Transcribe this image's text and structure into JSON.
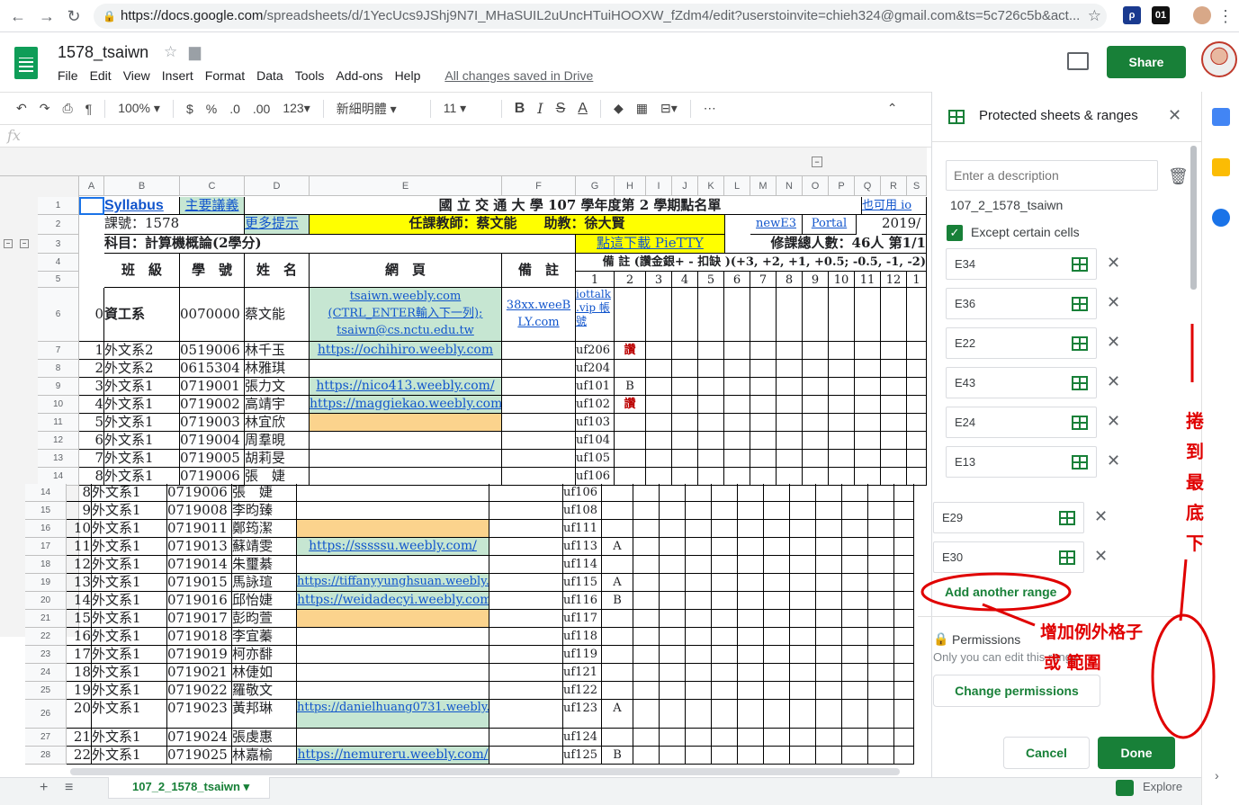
{
  "browser": {
    "url_host": "https://docs.google.com",
    "url_path": "/spreadsheets/d/1YecUcs9JShj9N7I_MHaSUIL2uUncHTuiHOOXW_fZdm4/edit?userstoinvite=chieh324@gmail.com&ts=5c726c5b&act..."
  },
  "doc": {
    "title": "1578_tsaiwn",
    "menus": [
      "File",
      "Edit",
      "View",
      "Insert",
      "Format",
      "Data",
      "Tools",
      "Add-ons",
      "Help"
    ],
    "saved_status": "All changes saved in Drive",
    "share_label": "Share"
  },
  "toolbar": {
    "zoom": "100%",
    "currency": "$",
    "percent": "%",
    "dec_less": ".0",
    "dec_more": ".00",
    "format_more": "123",
    "font": "新細明體",
    "font_size": "11",
    "bold": "B",
    "italic": "I",
    "strike": "S",
    "textcolor": "A"
  },
  "fx": "fx",
  "columns": [
    "A",
    "B",
    "C",
    "D",
    "E",
    "F",
    "G",
    "H",
    "I",
    "J",
    "K",
    "L",
    "M",
    "N",
    "O",
    "P",
    "Q",
    "R",
    "S"
  ],
  "top_rows": {
    "r1": {
      "num": "1",
      "b": "Syllabus",
      "c": "主要議義",
      "title": "國 立 交 通 大 學 107 學年度第 2 學期點名單",
      "right": "也可用 io"
    },
    "r2": {
      "num": "2",
      "b": "課號：1578",
      "c": "更多提示",
      "teacher": "任課教師：蔡文能　　助教：徐大賢",
      "newe3": "newE3",
      "portal": "Portal",
      "year": "2019/"
    },
    "r3": {
      "num": "3",
      "b": "科目：計算機概論(2學分)",
      "g": "點這下載 PieTTY",
      "total": "修課總人數：46人 第1/1"
    },
    "r4": {
      "num": "4",
      "b": "班　級",
      "c": "學　號",
      "d": "姓　名",
      "e": "網　頁",
      "f": "備　註",
      "notes": "備 註 (讚金銀+ - 扣缺 )(+3, +2, +1, +0.5; -0.5, -1, -2)"
    },
    "r5": {
      "num": "5",
      "nums": [
        "1",
        "2",
        "3",
        "4",
        "5",
        "6",
        "7",
        "8",
        "9",
        "10",
        "11",
        "12",
        "1"
      ]
    },
    "r6": {
      "num": "6",
      "a": "0",
      "b": "資工系",
      "c": "0070000",
      "d": "蔡文能",
      "e1": "tsaiwn.weebly.com",
      "e2": "(CTRL_ENTER輸入下一列);",
      "e3": "tsaiwn@cs.nctu.edu.tw",
      "f": "38xx.weeB LY.com",
      "g": "iottalk .vip 帳號"
    }
  },
  "rows": [
    {
      "num": "7",
      "a": "1",
      "b": "外文系2",
      "c": "0519006",
      "d": "林千玉",
      "e": "https://ochihiro.weebly.com",
      "g": "uf206",
      "h": "讚"
    },
    {
      "num": "8",
      "a": "2",
      "b": "外文系2",
      "c": "0615304",
      "d": "林雅琪",
      "e": "",
      "g": "uf204",
      "h": ""
    },
    {
      "num": "9",
      "a": "3",
      "b": "外文系1",
      "c": "0719001",
      "d": "張力文",
      "e": "https://nico413.weebly.com/",
      "g": "uf101",
      "h": "B"
    },
    {
      "num": "10",
      "a": "4",
      "b": "外文系1",
      "c": "0719002",
      "d": "高靖宇",
      "e": "https://maggiekao.weebly.com/",
      "g": "uf102",
      "h": "讚"
    },
    {
      "num": "11",
      "a": "5",
      "b": "外文系1",
      "c": "0719003",
      "d": "林宜欣",
      "e": "",
      "g": "uf103",
      "h": ""
    },
    {
      "num": "12",
      "a": "6",
      "b": "外文系1",
      "c": "0719004",
      "d": "周羣晛",
      "e": "",
      "g": "uf104",
      "h": ""
    },
    {
      "num": "13",
      "a": "7",
      "b": "外文系1",
      "c": "0719005",
      "d": "胡莉旻",
      "e": "",
      "g": "uf105",
      "h": ""
    },
    {
      "num": "14",
      "a": "8",
      "b": "外文系1",
      "c": "0719006",
      "d": "張　婕",
      "e": "",
      "g": "uf106",
      "h": ""
    }
  ],
  "rows2": [
    {
      "num": "14",
      "a": "8",
      "b": "外文系1",
      "c": "0719006",
      "d": "張　婕",
      "e": "",
      "g": "uf106",
      "h": ""
    },
    {
      "num": "15",
      "a": "9",
      "b": "外文系1",
      "c": "0719008",
      "d": "李昀臻",
      "e": "",
      "g": "uf108",
      "h": ""
    },
    {
      "num": "16",
      "a": "10",
      "b": "外文系1",
      "c": "0719011",
      "d": "鄭筠潔",
      "e": "",
      "g": "uf111",
      "h": ""
    },
    {
      "num": "17",
      "a": "11",
      "b": "外文系1",
      "c": "0719013",
      "d": "蘇靖雯",
      "e": "https://sssssu.weebly.com/",
      "g": "uf113",
      "h": "A"
    },
    {
      "num": "18",
      "a": "12",
      "b": "外文系1",
      "c": "0719014",
      "d": "朱璽綦",
      "e": "",
      "g": "uf114",
      "h": ""
    },
    {
      "num": "19",
      "a": "13",
      "b": "外文系1",
      "c": "0719015",
      "d": "馬詠瑄",
      "e": "https://tiffanyyunghsuan.weebly.com",
      "g": "uf115",
      "h": "A"
    },
    {
      "num": "20",
      "a": "14",
      "b": "外文系1",
      "c": "0719016",
      "d": "邱怡婕",
      "e": "https://weidadecyi.weebly.com",
      "g": "uf116",
      "h": "B"
    },
    {
      "num": "21",
      "a": "15",
      "b": "外文系1",
      "c": "0719017",
      "d": "彭昀萱",
      "e": "",
      "g": "uf117",
      "h": ""
    },
    {
      "num": "22",
      "a": "16",
      "b": "外文系1",
      "c": "0719018",
      "d": "李宜蓁",
      "e": "",
      "g": "uf118",
      "h": ""
    },
    {
      "num": "23",
      "a": "17",
      "b": "外文系1",
      "c": "0719019",
      "d": "柯亦馡",
      "e": "",
      "g": "uf119",
      "h": ""
    },
    {
      "num": "24",
      "a": "18",
      "b": "外文系1",
      "c": "0719021",
      "d": "林倢如",
      "e": "",
      "g": "uf121",
      "h": ""
    },
    {
      "num": "25",
      "a": "19",
      "b": "外文系1",
      "c": "0719022",
      "d": "羅敬文",
      "e": "",
      "g": "uf122",
      "h": ""
    },
    {
      "num": "26",
      "a": "20",
      "b": "外文系1",
      "c": "0719023",
      "d": "黃邦琳",
      "e": "https://danielhuang0731.weebly.com/",
      "g": "uf123",
      "h": "A"
    },
    {
      "num": "27",
      "a": "21",
      "b": "外文系1",
      "c": "0719024",
      "d": "張虔惠",
      "e": "",
      "g": "uf124",
      "h": ""
    },
    {
      "num": "28",
      "a": "22",
      "b": "外文系1",
      "c": "0719025",
      "d": "林嘉榆",
      "e": "https://nemureru.weebly.com/",
      "g": "uf125",
      "h": "B"
    }
  ],
  "panel": {
    "title": "Protected sheets & ranges",
    "desc_placeholder": "Enter a description",
    "sheet": "107_2_1578_tsaiwn",
    "except_label": "Except certain cells",
    "ranges": [
      "E34",
      "E36",
      "E22",
      "E43",
      "E24",
      "E13",
      "E29",
      "E30"
    ],
    "add_range": "Add another range",
    "perm_title": "Permissions",
    "perm_desc": "Only you can edit this range",
    "change_perm": "Change permissions",
    "cancel": "Cancel",
    "done": "Done"
  },
  "bottom": {
    "sheet_tab": "107_2_1578_tsaiwn",
    "explore": "Explore"
  },
  "annotations": {
    "scroll_note": [
      "捲",
      "到",
      "最",
      "底",
      "下"
    ],
    "add_note_1": "增加例外格子",
    "add_note_2": "或 範圍"
  }
}
